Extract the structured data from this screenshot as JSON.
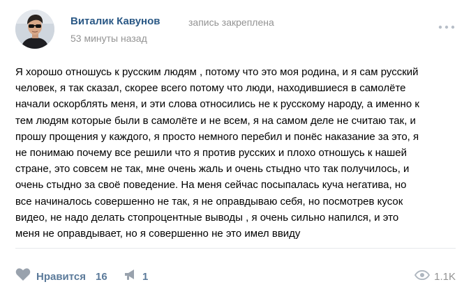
{
  "post": {
    "author": {
      "name": "Виталик Кавунов",
      "pinned_note": "запись закреплена",
      "time": "53 минуты назад",
      "avatar_icon": "avatar-photo"
    },
    "text_lines": [
      "Я хорошо отношусь к русским людям , потому что это моя родина, и я сам русский",
      "человек, я так сказал, скорее всего потому что люди, находившиеся в самолёте",
      "начали оскорблять меня, и эти слова относились не к русскому народу, а именно к",
      "тем людям которые были в самолёте и не всем, я на самом деле не считаю так, и",
      "прошу прощения у каждого, я просто немного перебил и понёс наказание за это, я",
      "не понимаю почему все решили что я против русских и плохо отношусь к нашей",
      "стране, это совсем не так, мне очень жаль и очень стыдно что так получилось, и",
      "очень стыдно за своё поведение. На меня сейчас посыпалась куча негатива, но",
      "все начиналось совершенно не так, я не оправдываю себя, но посмотрев кусок",
      "видео, не надо делать стопроцентные выводы , я очень сильно напился, и это",
      "меня не оправдывает, но я совершенно не это имел ввиду"
    ],
    "actions": {
      "like_label": "Нравится",
      "like_count": "16",
      "like_icon": "heart-icon",
      "repost_count": "1",
      "repost_icon": "megaphone-icon",
      "views_count": "1.1K",
      "views_icon": "eye-icon",
      "menu_icon": "more-dots-icon"
    },
    "colors": {
      "author_link": "#2a5885",
      "meta_gray": "#939393",
      "action_blue": "#5b7a9a",
      "icon_gray": "#99a2ad"
    }
  }
}
